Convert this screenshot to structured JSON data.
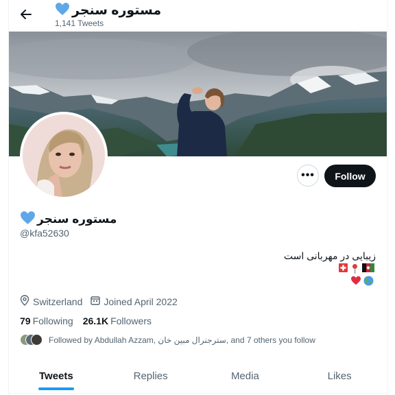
{
  "header": {
    "back_icon": "arrow-left-icon",
    "title": "مستوره سنجر",
    "tweets_count": "1,141 Tweets"
  },
  "profile": {
    "display_name": "مستوره سنجر",
    "handle": "@kfa52630",
    "bio": "زیبایی در مهربانی است",
    "location": "Switzerland",
    "joined": "Joined April 2022",
    "following_count": "79",
    "following_label": "Following",
    "followers_count": "26.1K",
    "followers_label": "Followers",
    "followed_by": "Followed by Abdullah Azzam, سترجنرال مبین خان, and 7 others you follow"
  },
  "actions": {
    "more_label": "•••",
    "follow_label": "Follow"
  },
  "tabs": [
    {
      "label": "Tweets",
      "active": true
    },
    {
      "label": "Replies",
      "active": false
    },
    {
      "label": "Media",
      "active": false
    },
    {
      "label": "Likes",
      "active": false
    }
  ],
  "colors": {
    "accent": "#1d9bf0",
    "follow_button": "#0f1419",
    "heart": "#5fa8e8"
  }
}
